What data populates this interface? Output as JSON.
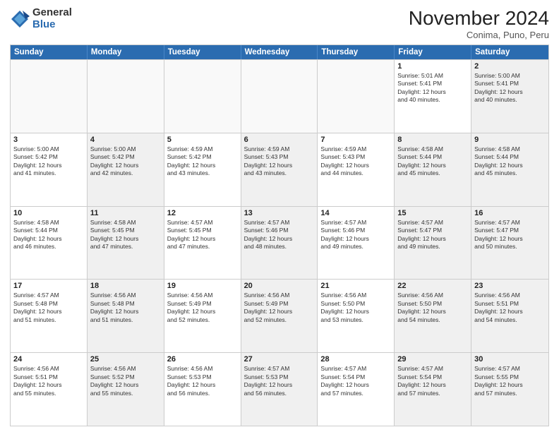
{
  "logo": {
    "general": "General",
    "blue": "Blue"
  },
  "header": {
    "month": "November 2024",
    "location": "Conima, Puno, Peru"
  },
  "weekdays": [
    "Sunday",
    "Monday",
    "Tuesday",
    "Wednesday",
    "Thursday",
    "Friday",
    "Saturday"
  ],
  "rows": [
    [
      {
        "day": "",
        "info": "",
        "empty": true
      },
      {
        "day": "",
        "info": "",
        "empty": true
      },
      {
        "day": "",
        "info": "",
        "empty": true
      },
      {
        "day": "",
        "info": "",
        "empty": true
      },
      {
        "day": "",
        "info": "",
        "empty": true
      },
      {
        "day": "1",
        "info": "Sunrise: 5:01 AM\nSunset: 5:41 PM\nDaylight: 12 hours\nand 40 minutes."
      },
      {
        "day": "2",
        "info": "Sunrise: 5:00 AM\nSunset: 5:41 PM\nDaylight: 12 hours\nand 40 minutes.",
        "shaded": true
      }
    ],
    [
      {
        "day": "3",
        "info": "Sunrise: 5:00 AM\nSunset: 5:42 PM\nDaylight: 12 hours\nand 41 minutes."
      },
      {
        "day": "4",
        "info": "Sunrise: 5:00 AM\nSunset: 5:42 PM\nDaylight: 12 hours\nand 42 minutes.",
        "shaded": true
      },
      {
        "day": "5",
        "info": "Sunrise: 4:59 AM\nSunset: 5:42 PM\nDaylight: 12 hours\nand 43 minutes."
      },
      {
        "day": "6",
        "info": "Sunrise: 4:59 AM\nSunset: 5:43 PM\nDaylight: 12 hours\nand 43 minutes.",
        "shaded": true
      },
      {
        "day": "7",
        "info": "Sunrise: 4:59 AM\nSunset: 5:43 PM\nDaylight: 12 hours\nand 44 minutes."
      },
      {
        "day": "8",
        "info": "Sunrise: 4:58 AM\nSunset: 5:44 PM\nDaylight: 12 hours\nand 45 minutes.",
        "shaded": true
      },
      {
        "day": "9",
        "info": "Sunrise: 4:58 AM\nSunset: 5:44 PM\nDaylight: 12 hours\nand 45 minutes.",
        "shaded": true
      }
    ],
    [
      {
        "day": "10",
        "info": "Sunrise: 4:58 AM\nSunset: 5:44 PM\nDaylight: 12 hours\nand 46 minutes."
      },
      {
        "day": "11",
        "info": "Sunrise: 4:58 AM\nSunset: 5:45 PM\nDaylight: 12 hours\nand 47 minutes.",
        "shaded": true
      },
      {
        "day": "12",
        "info": "Sunrise: 4:57 AM\nSunset: 5:45 PM\nDaylight: 12 hours\nand 47 minutes."
      },
      {
        "day": "13",
        "info": "Sunrise: 4:57 AM\nSunset: 5:46 PM\nDaylight: 12 hours\nand 48 minutes.",
        "shaded": true
      },
      {
        "day": "14",
        "info": "Sunrise: 4:57 AM\nSunset: 5:46 PM\nDaylight: 12 hours\nand 49 minutes."
      },
      {
        "day": "15",
        "info": "Sunrise: 4:57 AM\nSunset: 5:47 PM\nDaylight: 12 hours\nand 49 minutes.",
        "shaded": true
      },
      {
        "day": "16",
        "info": "Sunrise: 4:57 AM\nSunset: 5:47 PM\nDaylight: 12 hours\nand 50 minutes.",
        "shaded": true
      }
    ],
    [
      {
        "day": "17",
        "info": "Sunrise: 4:57 AM\nSunset: 5:48 PM\nDaylight: 12 hours\nand 51 minutes."
      },
      {
        "day": "18",
        "info": "Sunrise: 4:56 AM\nSunset: 5:48 PM\nDaylight: 12 hours\nand 51 minutes.",
        "shaded": true
      },
      {
        "day": "19",
        "info": "Sunrise: 4:56 AM\nSunset: 5:49 PM\nDaylight: 12 hours\nand 52 minutes."
      },
      {
        "day": "20",
        "info": "Sunrise: 4:56 AM\nSunset: 5:49 PM\nDaylight: 12 hours\nand 52 minutes.",
        "shaded": true
      },
      {
        "day": "21",
        "info": "Sunrise: 4:56 AM\nSunset: 5:50 PM\nDaylight: 12 hours\nand 53 minutes."
      },
      {
        "day": "22",
        "info": "Sunrise: 4:56 AM\nSunset: 5:50 PM\nDaylight: 12 hours\nand 54 minutes.",
        "shaded": true
      },
      {
        "day": "23",
        "info": "Sunrise: 4:56 AM\nSunset: 5:51 PM\nDaylight: 12 hours\nand 54 minutes.",
        "shaded": true
      }
    ],
    [
      {
        "day": "24",
        "info": "Sunrise: 4:56 AM\nSunset: 5:51 PM\nDaylight: 12 hours\nand 55 minutes."
      },
      {
        "day": "25",
        "info": "Sunrise: 4:56 AM\nSunset: 5:52 PM\nDaylight: 12 hours\nand 55 minutes.",
        "shaded": true
      },
      {
        "day": "26",
        "info": "Sunrise: 4:56 AM\nSunset: 5:53 PM\nDaylight: 12 hours\nand 56 minutes."
      },
      {
        "day": "27",
        "info": "Sunrise: 4:57 AM\nSunset: 5:53 PM\nDaylight: 12 hours\nand 56 minutes.",
        "shaded": true
      },
      {
        "day": "28",
        "info": "Sunrise: 4:57 AM\nSunset: 5:54 PM\nDaylight: 12 hours\nand 57 minutes."
      },
      {
        "day": "29",
        "info": "Sunrise: 4:57 AM\nSunset: 5:54 PM\nDaylight: 12 hours\nand 57 minutes.",
        "shaded": true
      },
      {
        "day": "30",
        "info": "Sunrise: 4:57 AM\nSunset: 5:55 PM\nDaylight: 12 hours\nand 57 minutes.",
        "shaded": true
      }
    ]
  ]
}
